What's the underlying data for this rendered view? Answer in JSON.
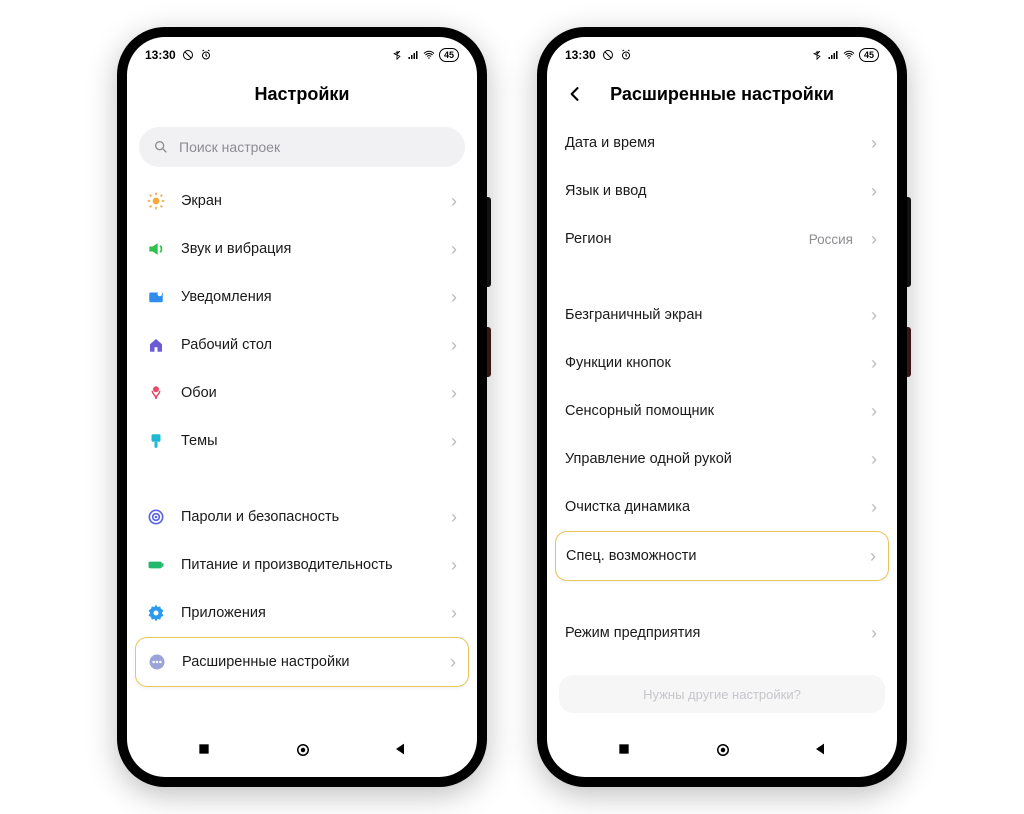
{
  "status": {
    "time": "13:30",
    "battery": "45"
  },
  "left": {
    "title": "Настройки",
    "search_placeholder": "Поиск настроек",
    "items": {
      "screen": "Экран",
      "sound": "Звук и вибрация",
      "notifications": "Уведомления",
      "desktop": "Рабочий стол",
      "wallpaper": "Обои",
      "themes": "Темы",
      "passwords": "Пароли и безопасность",
      "power": "Питание и производительность",
      "apps": "Приложения",
      "advanced": "Расширенные настройки"
    }
  },
  "right": {
    "title": "Расширенные настройки",
    "items": {
      "date": "Дата и время",
      "lang": "Язык и ввод",
      "region": "Регион",
      "region_value": "Россия",
      "fullscreen": "Безграничный экран",
      "buttons": "Функции кнопок",
      "touch_assist": "Сенсорный помощник",
      "onehand": "Управление одной рукой",
      "speaker": "Очистка динамика",
      "accessibility": "Спец. возможности",
      "enterprise": "Режим предприятия",
      "more_hint": "Нужны другие настройки?"
    }
  }
}
